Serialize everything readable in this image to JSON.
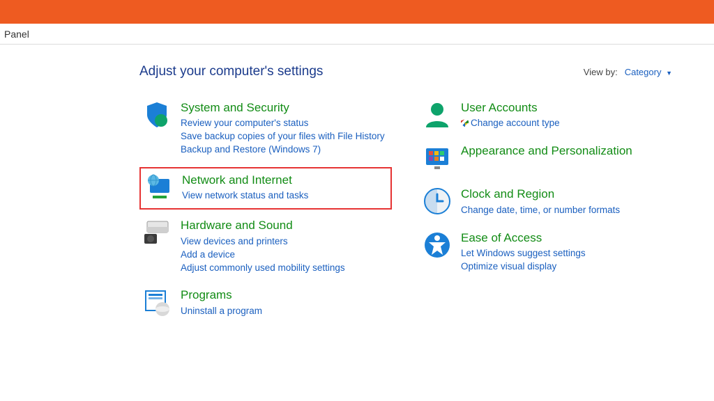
{
  "breadcrumb": "Panel",
  "header": {
    "title": "Adjust your computer's settings",
    "viewby_label": "View by:",
    "viewby_value": "Category"
  },
  "left": [
    {
      "icon": "shield-icon",
      "title": "System and Security",
      "links": [
        "Review your computer's status",
        "Save backup copies of your files with File History",
        "Backup and Restore (Windows 7)"
      ]
    },
    {
      "icon": "network-icon",
      "title": "Network and Internet",
      "highlight": true,
      "links": [
        "View network status and tasks"
      ]
    },
    {
      "icon": "hardware-icon",
      "title": "Hardware and Sound",
      "links": [
        "View devices and printers",
        "Add a device",
        "Adjust commonly used mobility settings"
      ]
    },
    {
      "icon": "programs-icon",
      "title": "Programs",
      "links": [
        "Uninstall a program"
      ]
    }
  ],
  "right": [
    {
      "icon": "user-icon",
      "title": "User Accounts",
      "links": [
        {
          "text": "Change account type",
          "shield": true
        }
      ]
    },
    {
      "icon": "appearance-icon",
      "title": "Appearance and Personalization",
      "links": []
    },
    {
      "icon": "clock-icon",
      "title": "Clock and Region",
      "links": [
        "Change date, time, or number formats"
      ]
    },
    {
      "icon": "ease-icon",
      "title": "Ease of Access",
      "links": [
        "Let Windows suggest settings",
        "Optimize visual display"
      ]
    }
  ]
}
